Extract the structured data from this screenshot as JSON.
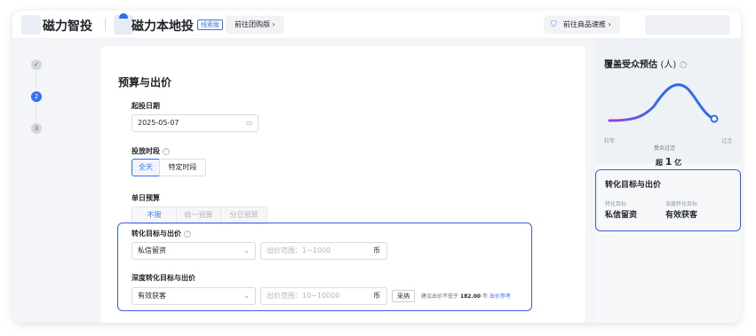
{
  "header": {
    "brand1": "磁力智投",
    "brand2": "磁力本地投",
    "badge": "线索版",
    "group_btn": "前往团购版 ›",
    "goods_btn": "前往商品速推 ›"
  },
  "steps": [
    {
      "label": "✓",
      "state": "done"
    },
    {
      "label": "2",
      "state": "active"
    },
    {
      "label": "3",
      "state": "todo"
    }
  ],
  "form": {
    "section_title": "预算与出价",
    "start_date_label": "起投日期",
    "start_date_value": "2025-05-07",
    "period_label": "投放时段",
    "period_options": [
      "全天",
      "特定时段"
    ],
    "budget_label": "单日预算",
    "budget_options": [
      "不限",
      "统一预算",
      "分日预算"
    ],
    "conv_label": "转化目标与出价",
    "conv_value": "私信留资",
    "conv_bid_placeholder": "出价范围：1~1000",
    "currency": "币",
    "deep_label": "深度转化目标与出价",
    "deep_value": "有效获客",
    "deep_bid_placeholder": "出价范围：10~10000",
    "adopt_btn": "采纳",
    "suggest_prefix": "建议出价不低于",
    "suggest_value": "182.00",
    "suggest_unit": "币",
    "suggest_link": "出价参考"
  },
  "audience": {
    "title": "覆盖受众预估",
    "unit": "(人)",
    "left_tick": "较窄",
    "right_tick": "过泛",
    "caption": "受众过泛",
    "estimate_prefix": "超",
    "estimate_value": "1",
    "estimate_unit": "亿"
  },
  "summary": {
    "title": "转化目标与出价",
    "conv_label": "转化目标",
    "conv_value": "私信留资",
    "deep_label": "深度转化目标",
    "deep_value": "有效获客"
  },
  "colors": {
    "accent": "#3370ff",
    "highlight_border": "#3b5fe0",
    "curve_start": "#a23ce0",
    "curve_end": "#2f6bf0"
  }
}
